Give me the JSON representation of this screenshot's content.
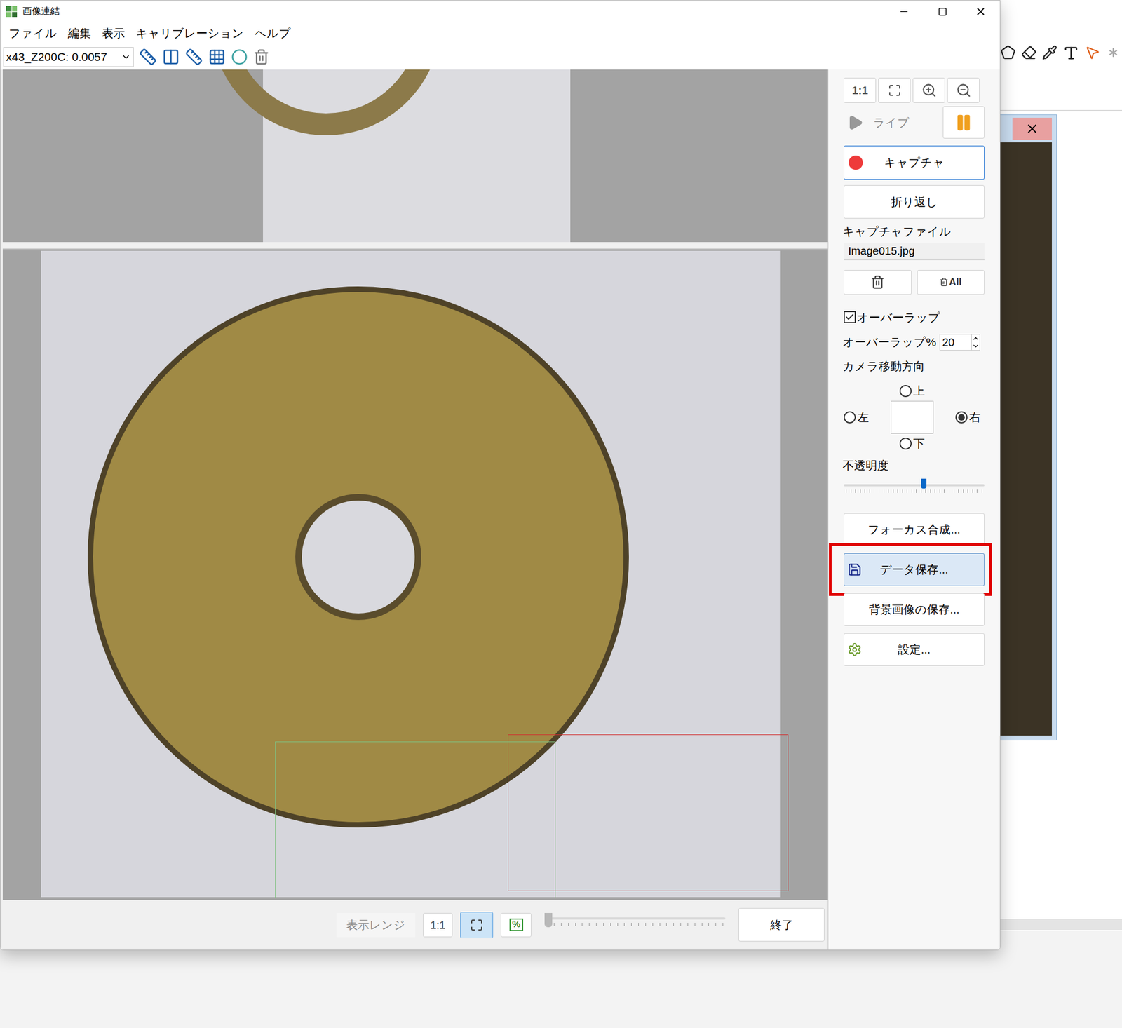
{
  "window": {
    "title": "画像連結"
  },
  "menu": [
    "ファイル",
    "編集",
    "表示",
    "キャリブレーション",
    "ヘルプ"
  ],
  "toolbar": {
    "calibration": "x43_Z200C: 0.0057"
  },
  "view_buttons": {
    "actual": "1:1"
  },
  "live": {
    "label": "ライブ",
    "disabled": true
  },
  "capture": {
    "label": "キャプチャ",
    "focused": true
  },
  "wrap": {
    "label": "折り返し"
  },
  "capture_file": {
    "label": "キャプチャファイル",
    "value": "Image015.jpg",
    "delete_all": "All"
  },
  "overlap": {
    "label": "オーバーラップ",
    "checked": true,
    "percent_label": "オーバーラップ%",
    "percent": "20"
  },
  "direction": {
    "label": "カメラ移動方向",
    "options": [
      {
        "label": "上",
        "selected": false
      },
      {
        "label": "左",
        "selected": false
      },
      {
        "label": "右",
        "selected": true
      },
      {
        "label": "下",
        "selected": false
      }
    ]
  },
  "opacity": {
    "label": "不透明度",
    "level": 0.58
  },
  "actions": [
    {
      "label": "フォーカス合成...",
      "kind": "plain",
      "highlighted": false
    },
    {
      "label": "データ保存...",
      "kind": "save",
      "highlighted": true
    },
    {
      "label": "背景画像の保存...",
      "kind": "plain",
      "highlighted": false
    },
    {
      "label": "設定...",
      "kind": "settings",
      "highlighted": false
    }
  ],
  "bottom_bar": {
    "range": "表示レンジ",
    "range_disabled": true,
    "actual": "1:1",
    "fit_selected": true,
    "percent": "%",
    "zoom_level": 0,
    "exit": "終了"
  }
}
